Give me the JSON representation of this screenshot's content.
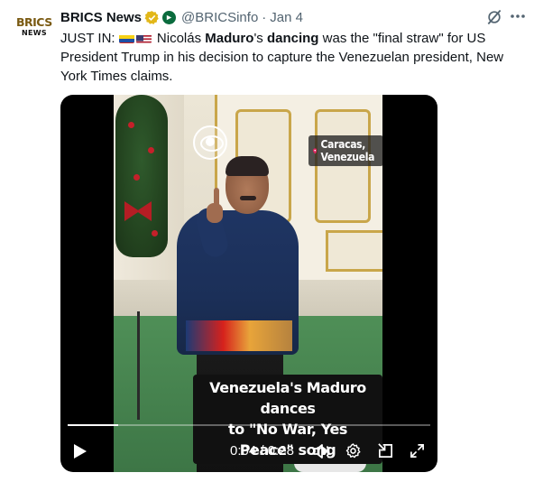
{
  "tweet": {
    "author_name": "BRICS News",
    "handle": "@BRICSinfo",
    "separator": "·",
    "date": "Jan 4",
    "avatar": {
      "line1": "BRICS",
      "line2": "NEWS"
    },
    "text": {
      "prefix": "JUST IN: ",
      "part1": " Nicolás ",
      "bold1": "Maduro",
      "part2": "'s ",
      "bold2": "dancing",
      "part3": " was the \"final straw\" for US President Trump in his decision to capture the Venezuelan president, New York Times claims."
    },
    "icons": [
      "verified-badge-icon",
      "affiliate-badge-icon",
      "grok-icon",
      "more-icon",
      "venezuela-flag-icon",
      "us-flag-icon"
    ]
  },
  "video": {
    "location_tag": "Caracas, Venezuela",
    "caption_line1": "Venezuela's Maduro dances",
    "caption_line2": "to \"No War, Yes Peace\" song",
    "time_current": "0:04",
    "time_separator": "/",
    "time_total": "0:28",
    "progress": 0.14,
    "icons": [
      "cbs-logo-icon",
      "location-pin-icon",
      "play-icon",
      "volume-icon",
      "settings-gear-icon",
      "picture-in-picture-icon",
      "fullscreen-icon"
    ]
  },
  "colors": {
    "text_primary": "#0f1419",
    "text_secondary": "#536471",
    "verified_gold": "#e2b719",
    "affiliate_green": "#0a6b3d",
    "video_bg": "#000000"
  }
}
